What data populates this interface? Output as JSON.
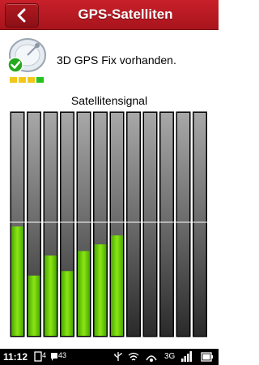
{
  "header": {
    "title": "GPS-Satelliten",
    "back_icon": "chevron-left-icon",
    "color": "#c01a24"
  },
  "status": {
    "icon": "satellite-dish-check-icon",
    "text": "3D GPS Fix vorhanden."
  },
  "signal": {
    "title": "Satellitensignal",
    "bar_color": "#7fdc10",
    "bar_count": 12,
    "levels": [
      0.49,
      0.27,
      0.36,
      0.29,
      0.38,
      0.41,
      0.45,
      0,
      0,
      0,
      0,
      0
    ]
  },
  "statusbar": {
    "time": "11:12",
    "notification_count": "4",
    "message_count": "43",
    "network": "3G",
    "icons": [
      "notification-icon",
      "message-icon",
      "battery-icon",
      "usb-icon",
      "wifi-icon",
      "network-icon",
      "signal-icon"
    ]
  }
}
